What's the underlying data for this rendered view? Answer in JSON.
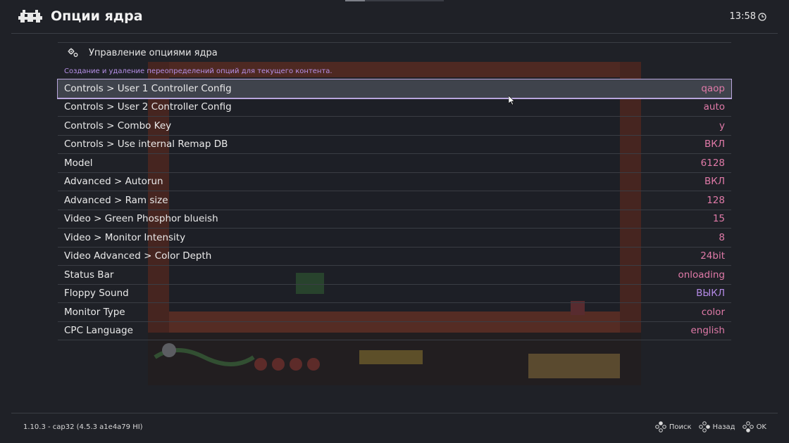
{
  "header": {
    "title": "Опции ядра",
    "clock": "13:58",
    "logo_icon": "retroarch-invader-icon",
    "clock_icon": "clock-icon"
  },
  "manage": {
    "label": "Управление опциями ядра",
    "icon": "gears-icon",
    "sublabel": "Создание и удаление переопределений опций для текущего контента."
  },
  "options": [
    {
      "label": "Controls > User 1 Controller Config",
      "value": "qaop"
    },
    {
      "label": "Controls > User 2 Controller Config",
      "value": "auto"
    },
    {
      "label": "Controls > Combo Key",
      "value": "y"
    },
    {
      "label": "Controls > Use internal Remap DB",
      "value": "ВКЛ"
    },
    {
      "label": "Model",
      "value": "6128"
    },
    {
      "label": "Advanced > Autorun",
      "value": "ВКЛ"
    },
    {
      "label": "Advanced > Ram size",
      "value": "128"
    },
    {
      "label": "Video > Green Phosphor blueish",
      "value": "15"
    },
    {
      "label": "Video > Monitor Intensity",
      "value": "8"
    },
    {
      "label": "Video Advanced > Color Depth",
      "value": "24bit"
    },
    {
      "label": "Status Bar",
      "value": "onloading"
    },
    {
      "label": "Floppy Sound",
      "value": "ВЫКЛ"
    },
    {
      "label": "Monitor Type",
      "value": "color"
    },
    {
      "label": "CPC Language",
      "value": "english"
    }
  ],
  "footer": {
    "version": "1.10.3 - cap32 (4.5.3 a1e4a79 HI)",
    "hints": [
      {
        "label": "Поиск",
        "icon": "gamepad-button-icon"
      },
      {
        "label": "Назад",
        "icon": "gamepad-button-icon"
      },
      {
        "label": "OK",
        "icon": "gamepad-button-icon"
      }
    ]
  },
  "colors": {
    "value": "#e07aa8",
    "value_off": "#b48ae6",
    "sublabel": "#b690e8",
    "selection_border": "#b9a6dd"
  }
}
